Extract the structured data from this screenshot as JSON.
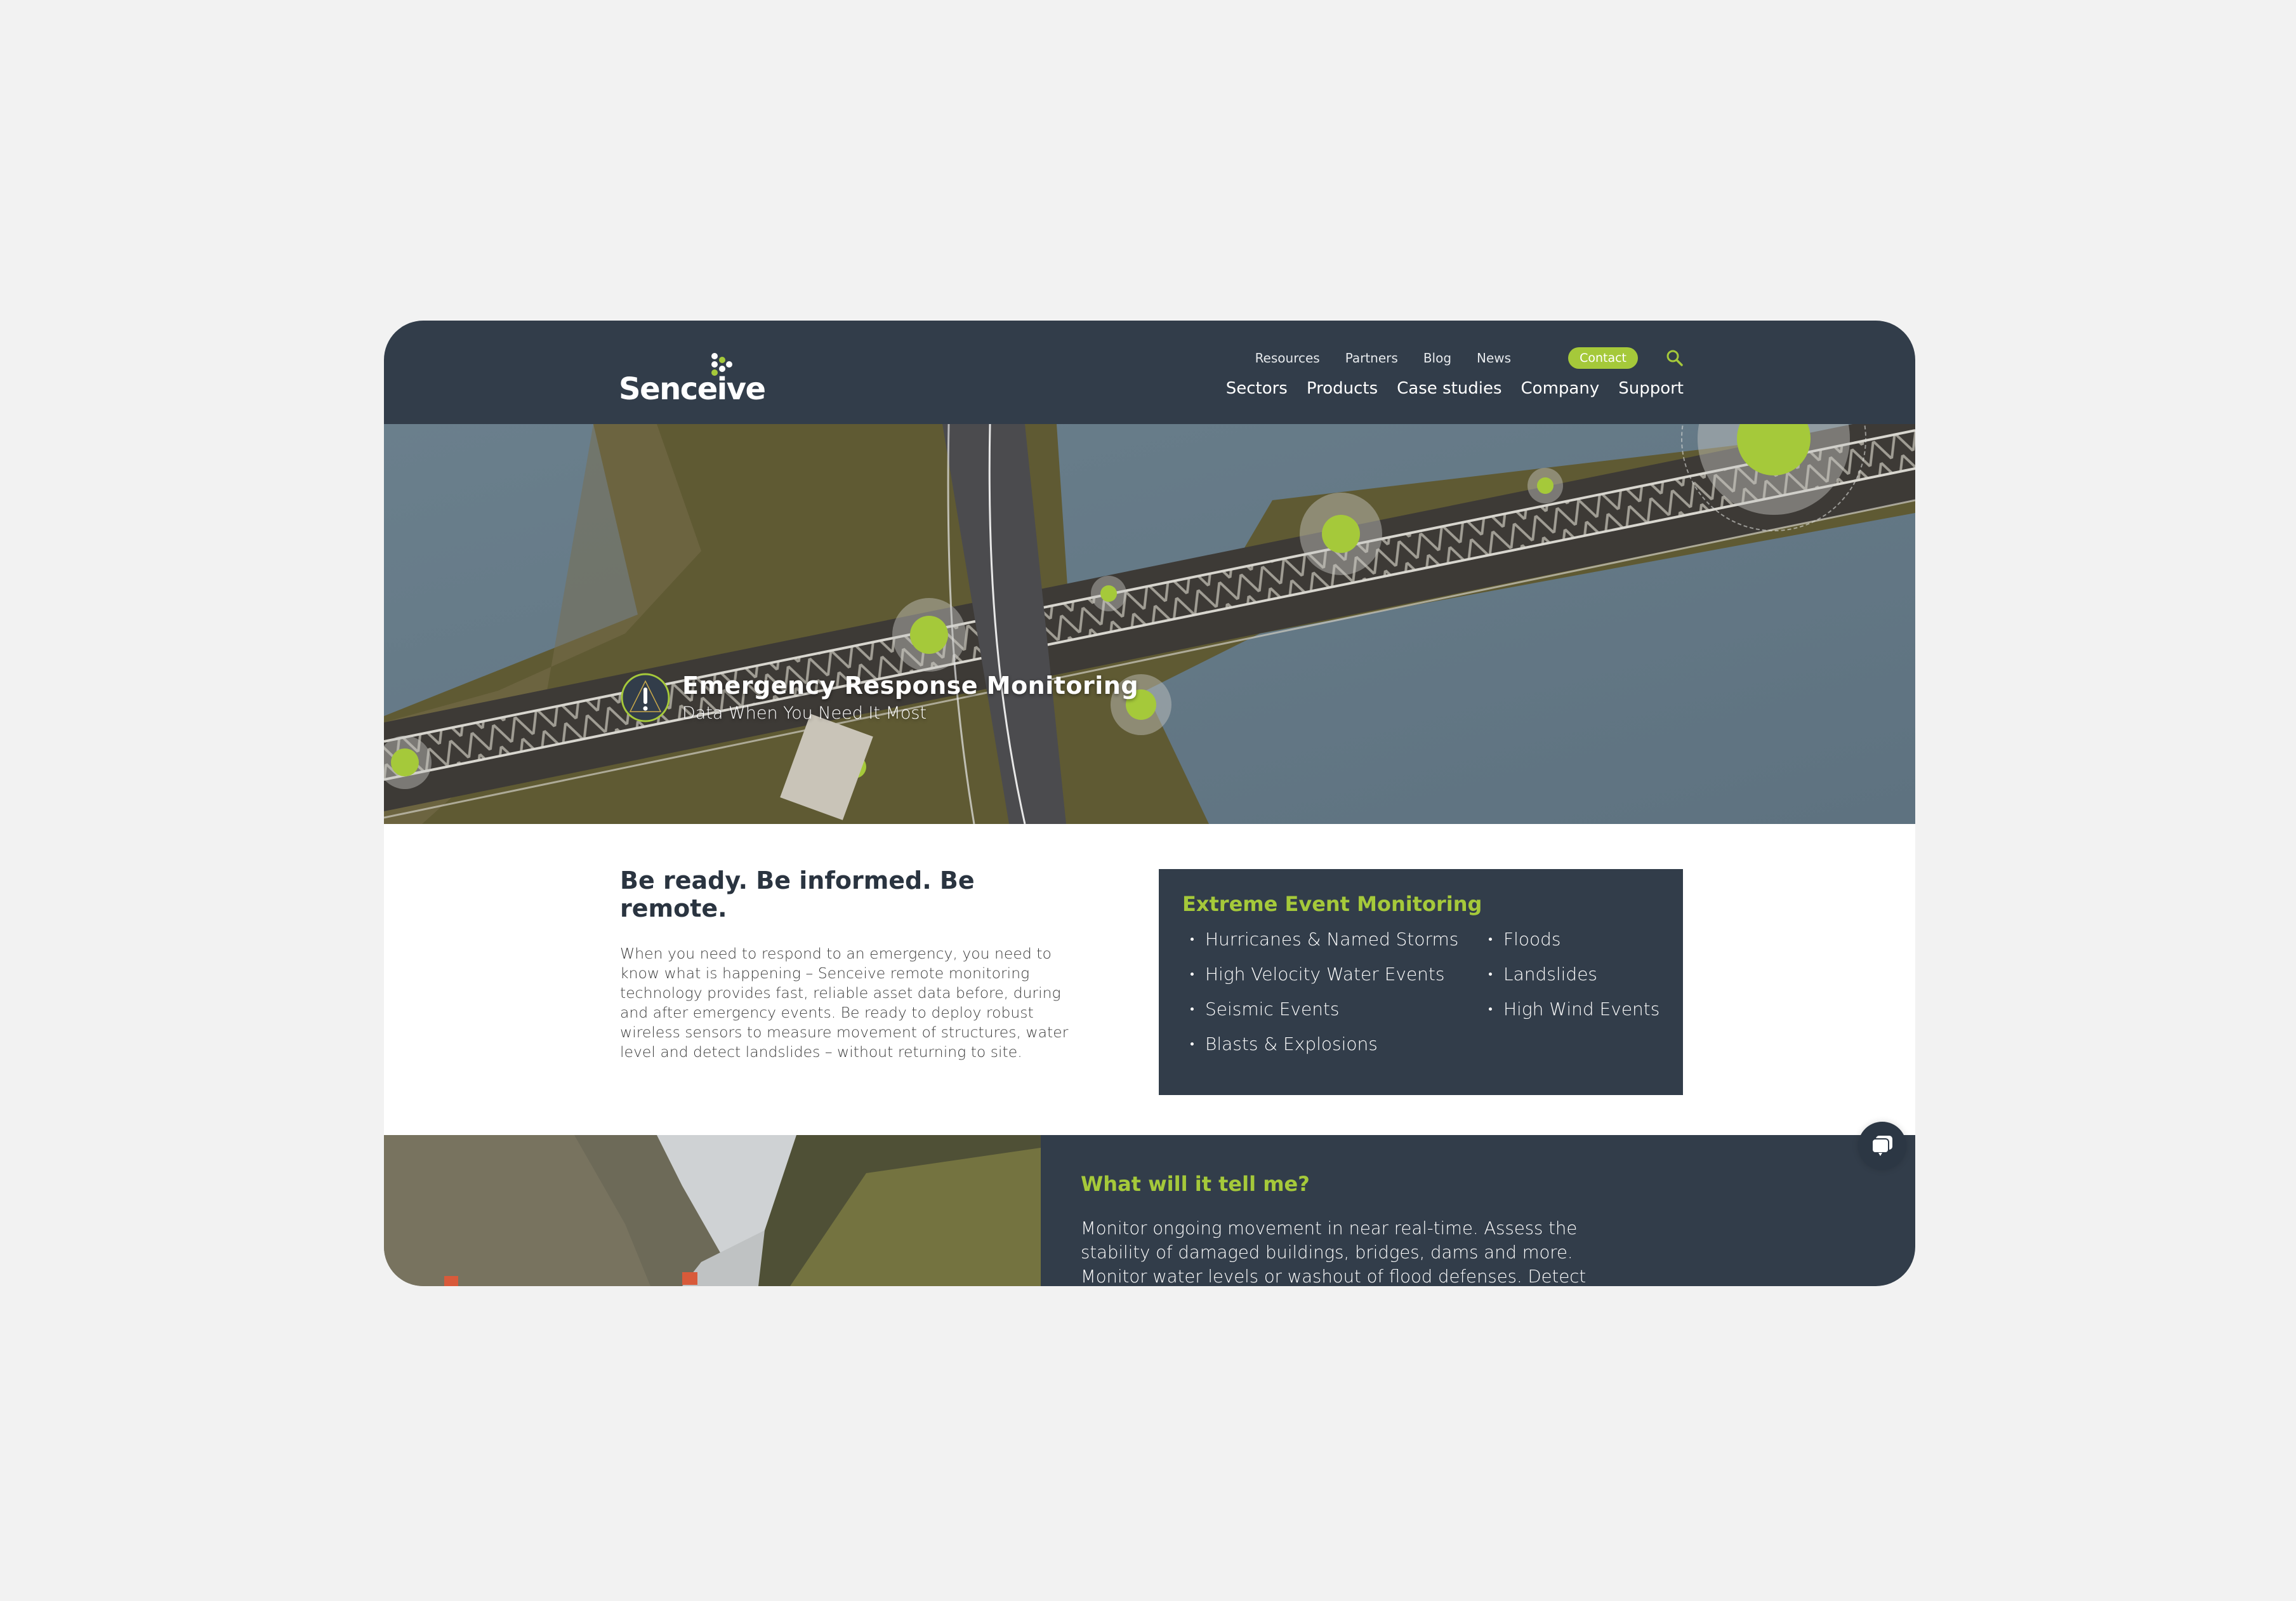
{
  "brand": {
    "name": "Senceive",
    "colors": {
      "primary_dark": "#323d4a",
      "accent_green": "#a5c93a",
      "page_bg": "#f2f2f2",
      "body_text": "#3d3d3d",
      "heading_text": "#2a3440"
    }
  },
  "header": {
    "logo_text": "Senceive",
    "utility_nav": [
      {
        "label": "Resources"
      },
      {
        "label": "Partners"
      },
      {
        "label": "Blog"
      },
      {
        "label": "News"
      }
    ],
    "contact_label": "Contact",
    "search_icon": "search-icon",
    "main_nav": [
      {
        "label": "Sectors"
      },
      {
        "label": "Products"
      },
      {
        "label": "Case studies"
      },
      {
        "label": "Company"
      },
      {
        "label": "Support"
      }
    ]
  },
  "hero": {
    "icon": "warning-triangle-icon",
    "title": "Emergency Response Monitoring",
    "subtitle": "Data When You Need It Most"
  },
  "intro": {
    "heading": "Be ready. Be informed. Be remote.",
    "body": "When you need to respond to an emergency, you need to know what is happening – Senceive remote monitoring technology provides fast, reliable asset data before, during and after emergency events. Be ready to deploy robust wireless sensors to measure movement of structures, water level and detect landslides – without returning to site."
  },
  "extreme_events": {
    "heading": "Extreme Event Monitoring",
    "items": [
      "Hurricanes & Named Storms",
      "Floods",
      "High Velocity Water Events",
      "Landslides",
      "Seismic Events",
      "High Wind Events",
      "Blasts & Explosions"
    ]
  },
  "what_it_tells": {
    "heading": "What will it tell me?",
    "body": "Monitor ongoing movement in near real-time. Assess the stability of damaged buildings, bridges, dams and more. Monitor water levels or washout of flood defenses. Detect"
  },
  "chat": {
    "icon": "chat-bubbles-icon"
  }
}
